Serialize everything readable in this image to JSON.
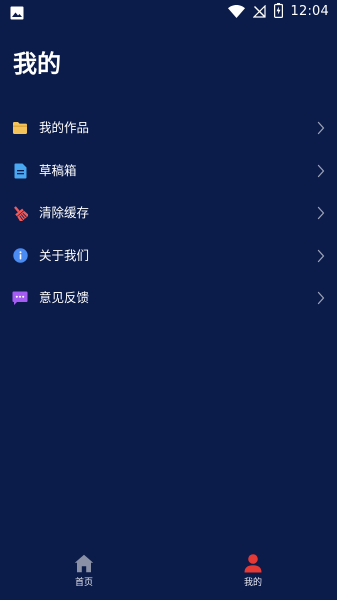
{
  "status_bar": {
    "time": "12:04",
    "left_icon": "image-icon",
    "right_icons": [
      "wifi-icon",
      "signal-off-icon",
      "battery-charging-icon"
    ]
  },
  "page": {
    "title": "我的"
  },
  "menu": {
    "items": [
      {
        "label": "我的作品",
        "icon": "folder-icon",
        "color": "#f4c45a"
      },
      {
        "label": "草稿箱",
        "icon": "document-icon",
        "color": "#4aa8f2"
      },
      {
        "label": "清除缓存",
        "icon": "broom-icon",
        "color": "#ef5a5a"
      },
      {
        "label": "关于我们",
        "icon": "info-icon",
        "color": "#4a8cf2"
      },
      {
        "label": "意见反馈",
        "icon": "chat-icon",
        "color": "#a55cf2"
      }
    ]
  },
  "bottom_nav": {
    "items": [
      {
        "label": "首页",
        "icon": "home-icon",
        "active": false
      },
      {
        "label": "我的",
        "icon": "user-icon",
        "active": true
      }
    ],
    "active_color": "#e53935",
    "inactive_color": "#8a91a6"
  }
}
